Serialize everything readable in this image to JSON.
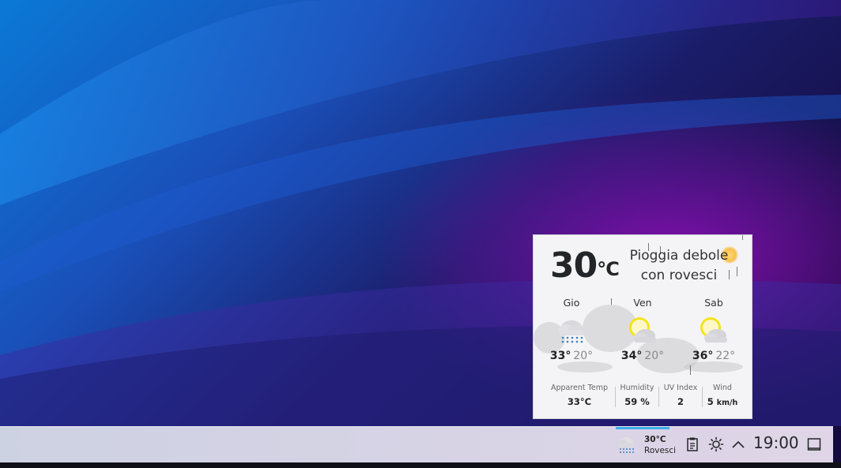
{
  "weather": {
    "current_temp": "30",
    "current_unit": "°C",
    "condition_line1": "Pioggia debole",
    "condition_line2": "con rovesci",
    "forecast": [
      {
        "day": "Gio",
        "icon": "rain-snow-cloud-icon",
        "high": "33°",
        "low": "20°"
      },
      {
        "day": "Ven",
        "icon": "partly-cloudy-icon",
        "high": "34°",
        "low": "20°"
      },
      {
        "day": "Sab",
        "icon": "partly-cloudy-icon",
        "high": "36°",
        "low": "22°"
      }
    ],
    "details": {
      "apparent_label": "Apparent Temp",
      "apparent_value": "33°C",
      "humidity_label": "Humidity",
      "humidity_value": "59 %",
      "uv_label": "UV Index",
      "uv_value": "2",
      "wind_label": "Wind",
      "wind_value": "5",
      "wind_unit": "km/h"
    }
  },
  "taskbar": {
    "weather_temp": "30°C",
    "weather_condition": "Rovesci",
    "clock": "19:00",
    "tray_icons": [
      "clipboard-icon",
      "brightness-icon",
      "chevron-up-icon",
      "show-desktop-icon"
    ]
  },
  "colors": {
    "accent": "#3daee9",
    "popup_bg": "#f4f4f6",
    "sun_yellow": "#f4e41b"
  }
}
